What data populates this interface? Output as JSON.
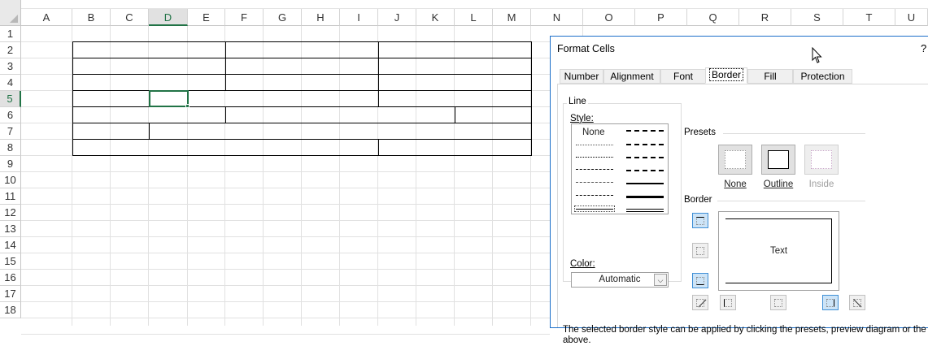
{
  "spreadsheet": {
    "columns": [
      "A",
      "B",
      "C",
      "D",
      "E",
      "F",
      "G",
      "H",
      "I",
      "J",
      "K",
      "L",
      "M",
      "N",
      "O",
      "P",
      "Q",
      "R",
      "S",
      "T",
      "U"
    ],
    "rows": [
      "1",
      "2",
      "3",
      "4",
      "5",
      "6",
      "7",
      "8",
      "9",
      "10",
      "11",
      "12",
      "13",
      "14",
      "15",
      "16",
      "17",
      "18"
    ],
    "active_cell": "D5"
  },
  "dialog": {
    "title": "Format Cells",
    "help_icon": "?",
    "tabs": [
      {
        "label": "Number",
        "active": false
      },
      {
        "label": "Alignment",
        "active": false
      },
      {
        "label": "Font",
        "active": false
      },
      {
        "label": "Border",
        "active": true
      },
      {
        "label": "Fill",
        "active": false
      },
      {
        "label": "Protection",
        "active": false
      }
    ],
    "line": {
      "group_label": "Line",
      "style_label": "Style:",
      "none_label": "None",
      "color_label": "Color:",
      "color_value": "Automatic"
    },
    "presets": {
      "group_label": "Presets",
      "items": [
        {
          "label": "None",
          "enabled": true
        },
        {
          "label": "Outline",
          "enabled": true
        },
        {
          "label": "Inside",
          "enabled": false
        }
      ]
    },
    "border": {
      "group_label": "Border",
      "preview_text": "Text"
    },
    "hint_text_line1": "The selected border style can be applied by clicking the presets, preview diagram or the",
    "hint_text_line2": "above."
  },
  "colors": {
    "accent": "#217346",
    "dialog_border": "#1c6fc9",
    "selected_button": "#cde4f7"
  }
}
